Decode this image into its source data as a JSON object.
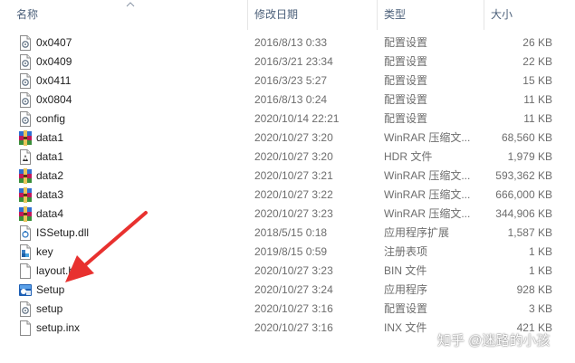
{
  "columns": {
    "name": "名称",
    "date": "修改日期",
    "type": "类型",
    "size": "大小"
  },
  "files": [
    {
      "name": "0x0407",
      "date": "2016/8/13 0:33",
      "type": "配置设置",
      "size": "26 KB",
      "icon": "settings-file-icon"
    },
    {
      "name": "0x0409",
      "date": "2016/3/21 23:34",
      "type": "配置设置",
      "size": "22 KB",
      "icon": "settings-file-icon"
    },
    {
      "name": "0x0411",
      "date": "2016/3/23 5:27",
      "type": "配置设置",
      "size": "15 KB",
      "icon": "settings-file-icon"
    },
    {
      "name": "0x0804",
      "date": "2016/8/13 0:24",
      "type": "配置设置",
      "size": "11 KB",
      "icon": "settings-file-icon"
    },
    {
      "name": "config",
      "date": "2020/10/14 22:21",
      "type": "配置设置",
      "size": "11 KB",
      "icon": "settings-file-icon"
    },
    {
      "name": "data1",
      "date": "2020/10/27 3:20",
      "type": "WinRAR 压缩文...",
      "size": "68,560 KB",
      "icon": "winrar-archive-icon"
    },
    {
      "name": "data1",
      "date": "2020/10/27 3:20",
      "type": "HDR 文件",
      "size": "1,979 KB",
      "icon": "hdr-file-icon"
    },
    {
      "name": "data2",
      "date": "2020/10/27 3:21",
      "type": "WinRAR 压缩文...",
      "size": "593,362 KB",
      "icon": "winrar-archive-icon"
    },
    {
      "name": "data3",
      "date": "2020/10/27 3:22",
      "type": "WinRAR 压缩文...",
      "size": "666,000 KB",
      "icon": "winrar-archive-icon"
    },
    {
      "name": "data4",
      "date": "2020/10/27 3:23",
      "type": "WinRAR 压缩文...",
      "size": "344,906 KB",
      "icon": "winrar-archive-icon"
    },
    {
      "name": "ISSetup.dll",
      "date": "2018/5/15 0:18",
      "type": "应用程序扩展",
      "size": "1,587 KB",
      "icon": "dll-file-icon"
    },
    {
      "name": "key",
      "date": "2019/8/15 0:59",
      "type": "注册表项",
      "size": "1 KB",
      "icon": "registry-file-icon"
    },
    {
      "name": "layout.b",
      "date": "2020/10/27 3:23",
      "type": "BIN 文件",
      "size": "1 KB",
      "icon": "blank-file-icon"
    },
    {
      "name": "Setup",
      "date": "2020/10/27 3:24",
      "type": "应用程序",
      "size": "928 KB",
      "icon": "setup-exe-icon"
    },
    {
      "name": "setup",
      "date": "2020/10/27 3:16",
      "type": "配置设置",
      "size": "3 KB",
      "icon": "settings-file-icon"
    },
    {
      "name": "setup.inx",
      "date": "2020/10/27 3:16",
      "type": "INX 文件",
      "size": "421 KB",
      "icon": "blank-file-icon"
    }
  ],
  "colors": {
    "header_text": "#4c607a",
    "arrow": "#e8312f"
  },
  "watermark": "知乎 @迷路的小孩"
}
